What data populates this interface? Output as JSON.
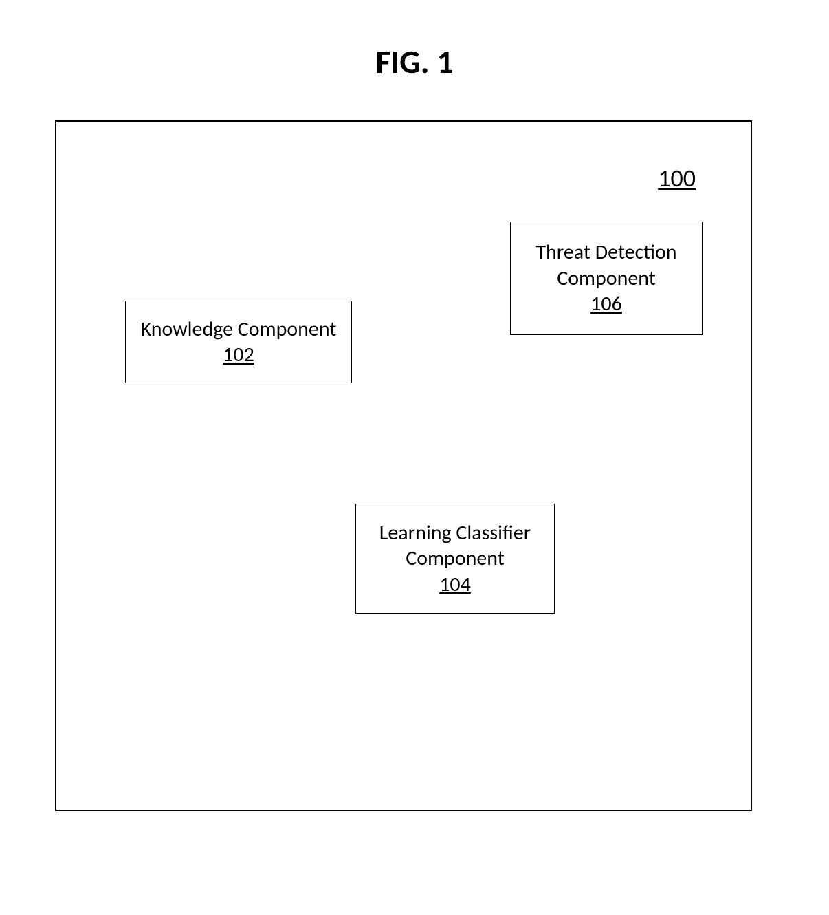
{
  "figure_title": "FIG. 1",
  "system_ref": "100",
  "components": {
    "knowledge": {
      "label": "Knowledge Component",
      "ref": "102"
    },
    "learning": {
      "label_line1": "Learning Classifier",
      "label_line2": "Component",
      "ref": "104"
    },
    "threat": {
      "label_line1": "Threat Detection",
      "label_line2": "Component",
      "ref": "106"
    }
  }
}
